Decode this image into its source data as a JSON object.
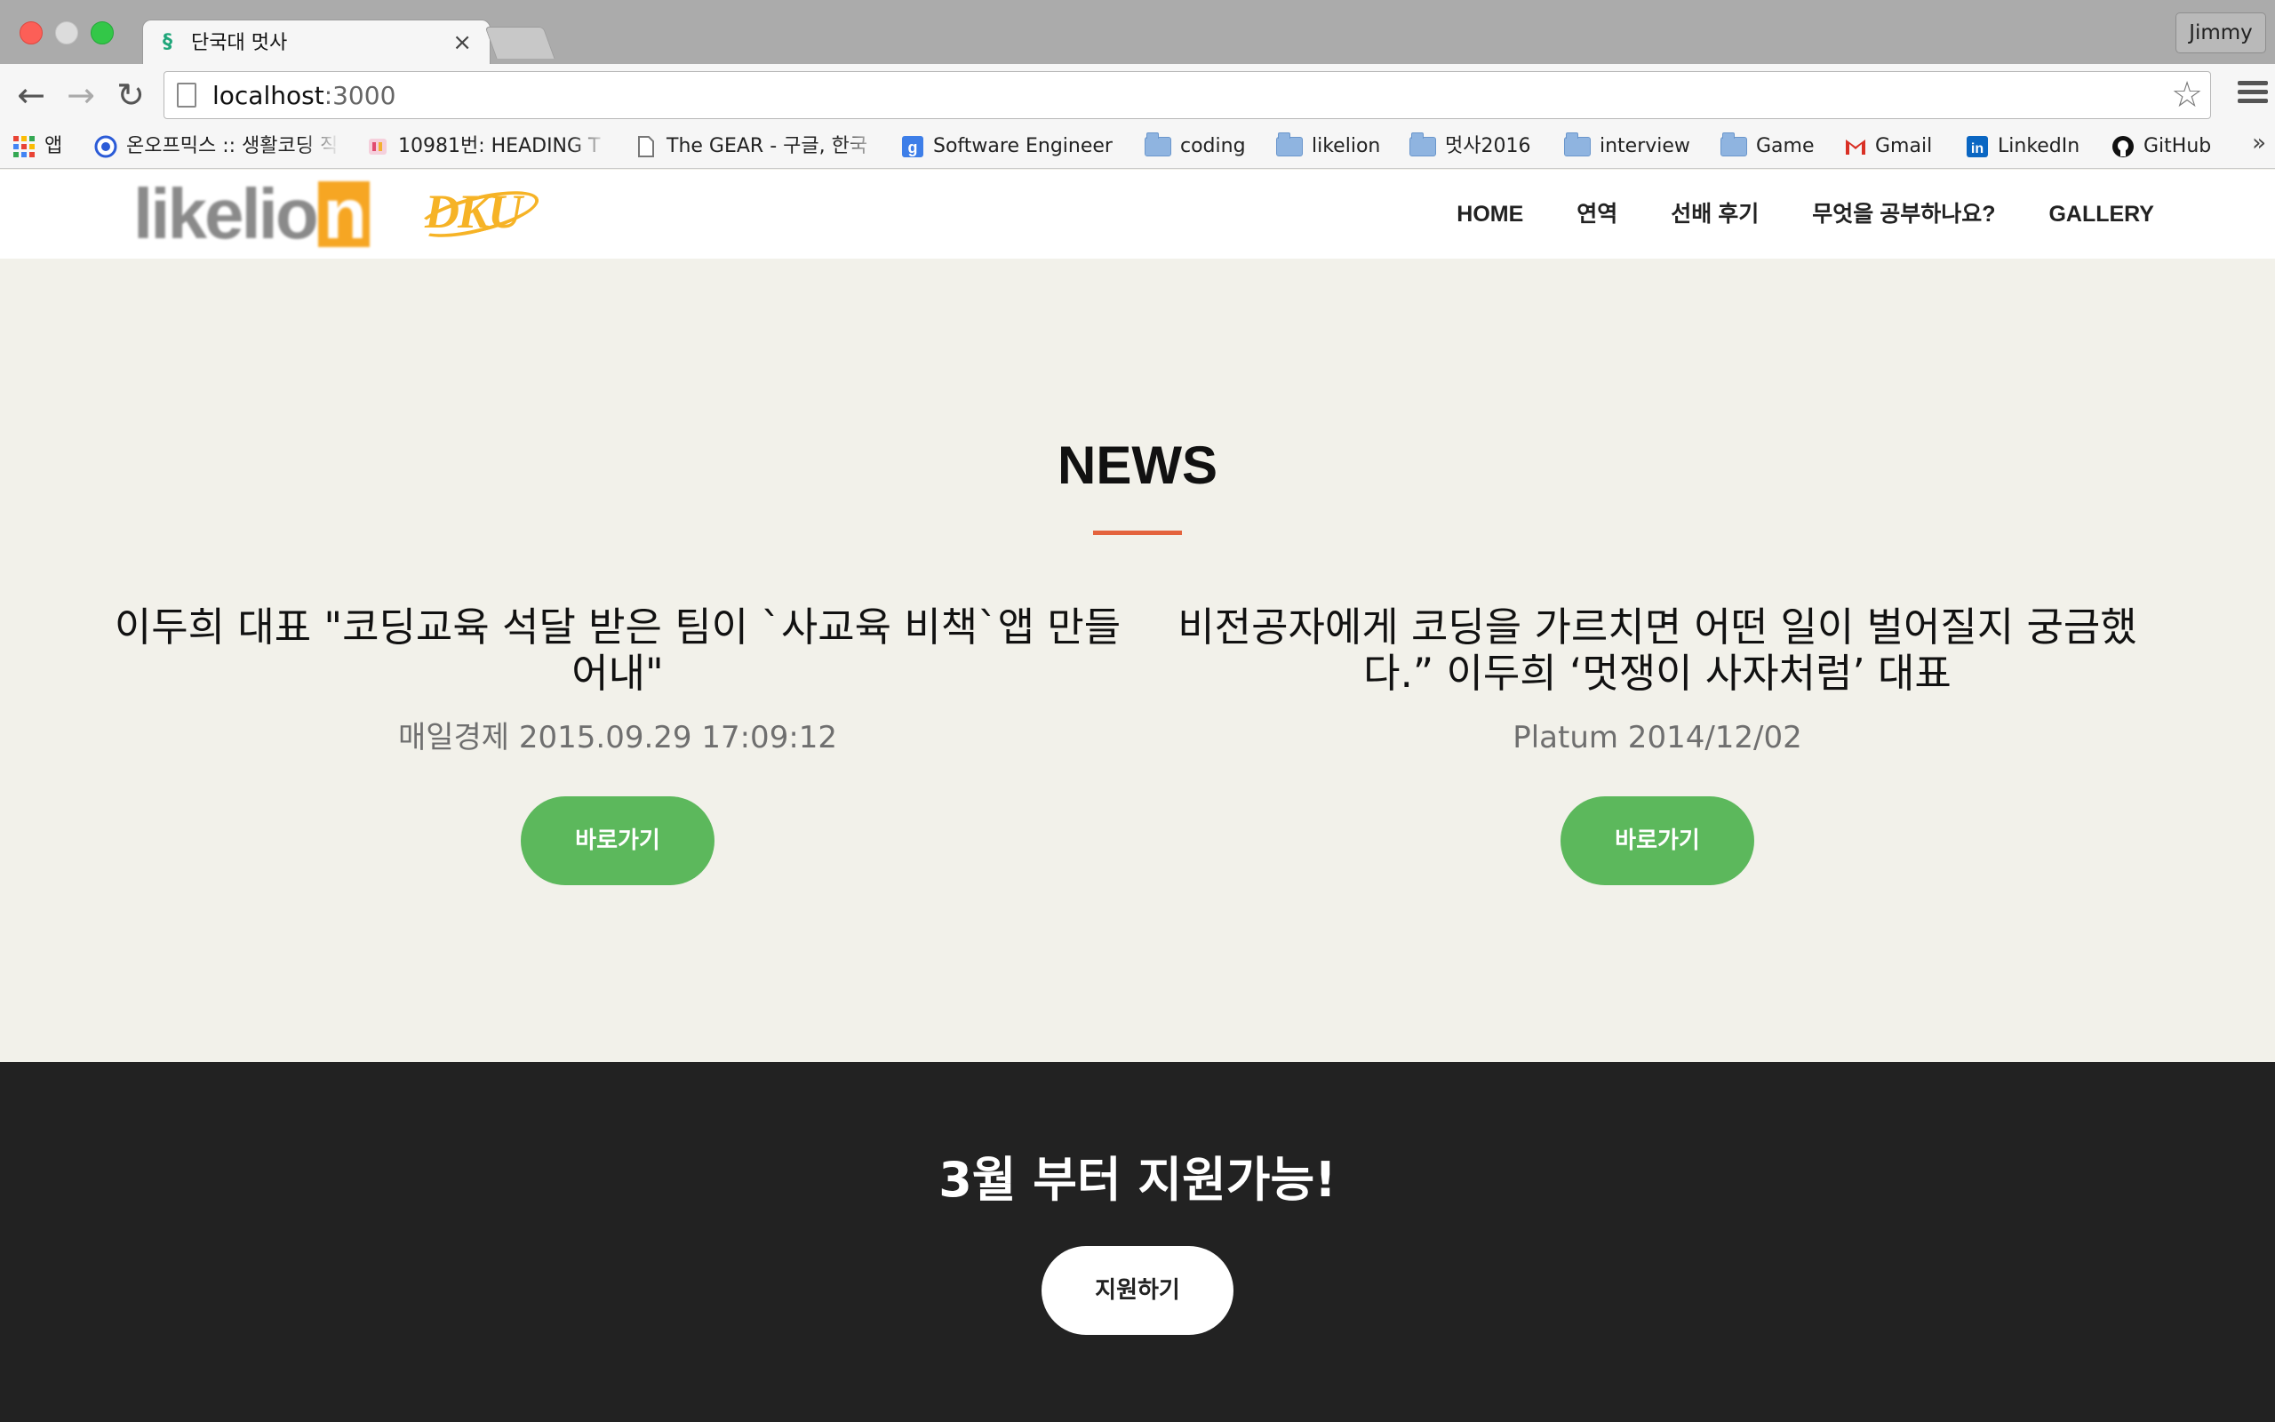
{
  "browser": {
    "tab_title": "단국대 멋사",
    "tab_close": "×",
    "profile_name": "Jimmy",
    "url_host": "localhost",
    "url_port": ":3000",
    "bookmarks": [
      {
        "label": "앱",
        "icon": "apps-grid-icon"
      },
      {
        "label": "온오프믹스 :: 생활코딩 직",
        "icon": "onoffmix-icon"
      },
      {
        "label": "10981번: HEADING T",
        "icon": "baekjoon-icon"
      },
      {
        "label": "The GEAR - 구글, 한국",
        "icon": "page-icon"
      },
      {
        "label": "Software Engineer",
        "icon": "google-icon"
      },
      {
        "label": "coding",
        "icon": "folder-icon"
      },
      {
        "label": "likelion",
        "icon": "folder-icon"
      },
      {
        "label": "멋사2016",
        "icon": "folder-icon"
      },
      {
        "label": "interview",
        "icon": "folder-icon"
      },
      {
        "label": "Game",
        "icon": "folder-icon"
      },
      {
        "label": "Gmail",
        "icon": "gmail-icon"
      },
      {
        "label": "LinkedIn",
        "icon": "linkedin-icon"
      },
      {
        "label": "GitHub",
        "icon": "github-icon"
      }
    ],
    "bookmarks_more": "»"
  },
  "site": {
    "logo_text": "likelio",
    "logo_n": "n",
    "logo_sub": "DKU",
    "nav": [
      "HOME",
      "연역",
      "선배 후기",
      "무엇을 공부하나요?",
      "GALLERY"
    ]
  },
  "news": {
    "title": "NEWS",
    "articles": [
      {
        "headline": "이두희 대표 \"코딩교육 석달 받은 팀이 `사교육 비책`앱 만들어내\"",
        "meta": "매일경제 2015.09.29 17:09:12",
        "button": "바로가기"
      },
      {
        "headline": "비전공자에게 코딩을 가르치면 어떤 일이 벌어질지 궁금했다.” 이두희 ‘멋쟁이 사자처럼’ 대표",
        "meta": "Platum 2014/12/02",
        "button": "바로가기"
      }
    ]
  },
  "apply": {
    "title": "3월 부터 지원가능!",
    "button": "지원하기"
  },
  "colors": {
    "accent_rule": "#e4633d",
    "button_green": "#5cb85c",
    "section_bg": "#f2f1ea",
    "footer_bg": "#222222",
    "logo_orange": "#f6a623"
  }
}
